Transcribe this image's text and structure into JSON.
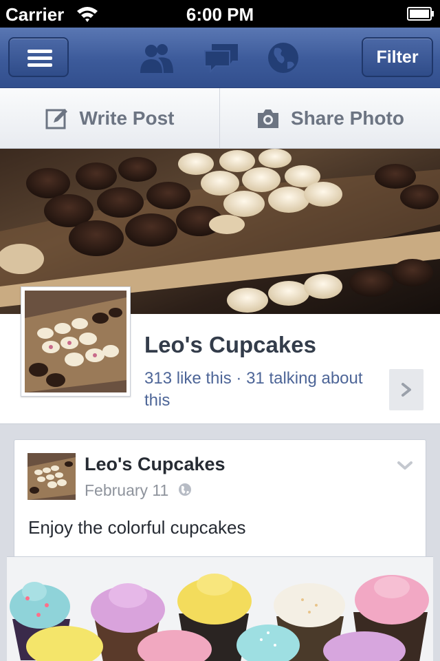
{
  "status_bar": {
    "carrier": "Carrier",
    "time": "6:00 PM"
  },
  "nav_bar": {
    "filter_label": "Filter",
    "icons": [
      "menu-icon",
      "friends-icon",
      "messages-icon",
      "globe-icon"
    ]
  },
  "publisher": {
    "write_post_label": "Write Post",
    "share_photo_label": "Share Photo"
  },
  "page": {
    "name": "Leo's Cupcakes",
    "stats": "313 like this · 31 talking about this"
  },
  "post": {
    "author": "Leo's Cupcakes",
    "date": "February 11",
    "text": "Enjoy the colorful cupcakes"
  },
  "colors": {
    "nav_blue": "#3c5a9a",
    "link_blue": "#4d6597",
    "text_dark": "#333c4a",
    "muted_gray": "#8e939c"
  }
}
